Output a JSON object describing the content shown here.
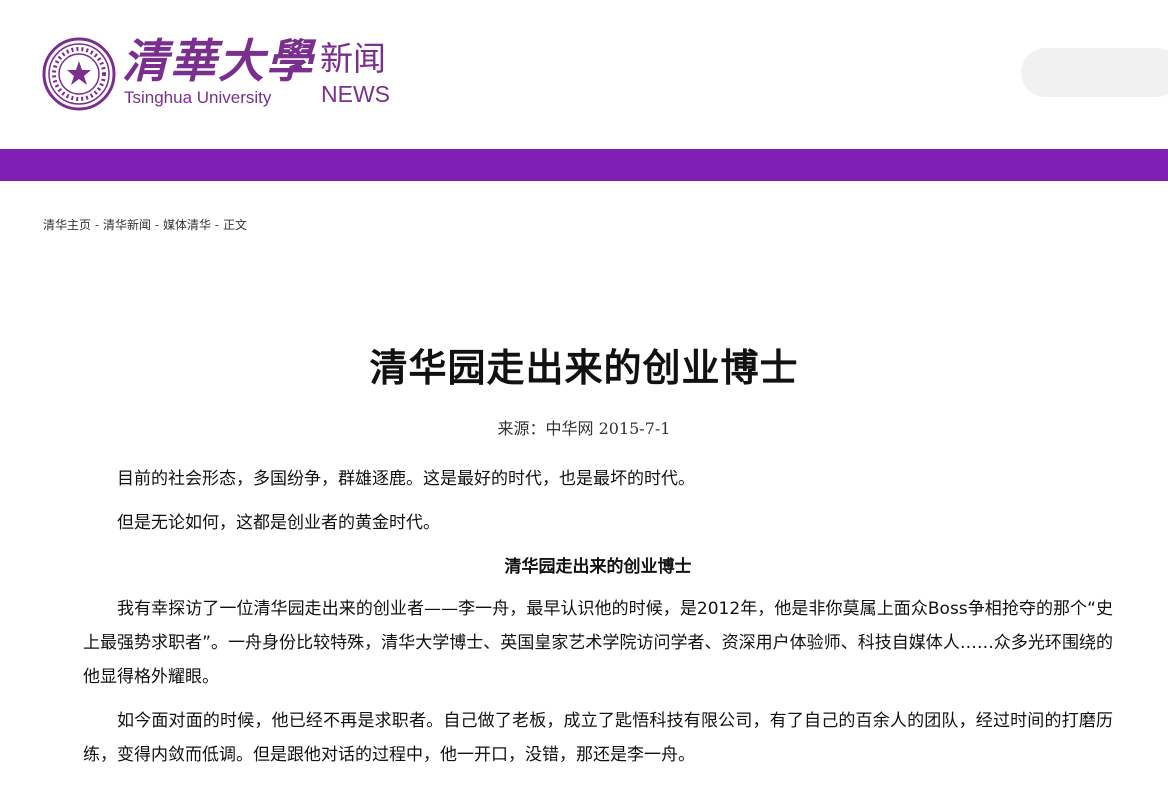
{
  "header": {
    "logo_cn": "清華大學",
    "logo_en": "Tsinghua University",
    "news_cn": "新闻",
    "news_en": "NEWS",
    "brand_color": "#7a2e8e",
    "band_color": "#7f1fb3"
  },
  "breadcrumb": {
    "home": "清华主页",
    "news": "清华新闻",
    "media": "媒体清华",
    "current": "正文",
    "separator": " - "
  },
  "article": {
    "title": "清华园走出来的创业博士",
    "source": "来源：中华网 2015-7-1",
    "paragraphs": [
      "目前的社会形态，多国纷争，群雄逐鹿。这是最好的时代，也是最坏的时代。",
      "但是无论如何，这都是创业者的黄金时代。"
    ],
    "subtitle": "清华园走出来的创业博士",
    "body": [
      "我有幸探访了一位清华园走出来的创业者——李一舟，最早认识他的时候，是2012年，他是非你莫属上面众Boss争相抢夺的那个“史上最强势求职者”。一舟身份比较特殊，清华大学博士、英国皇家艺术学院访问学者、资深用户体验师、科技自媒体人……众多光环围绕的他显得格外耀眼。",
      "如今面对面的时候，他已经不再是求职者。自己做了老板，成立了匙悟科技有限公司，有了自己的百余人的团队，经过时间的打磨历练，变得内敛而低调。但是跟他对话的过程中，他一开口，没错，那还是李一舟。"
    ]
  }
}
